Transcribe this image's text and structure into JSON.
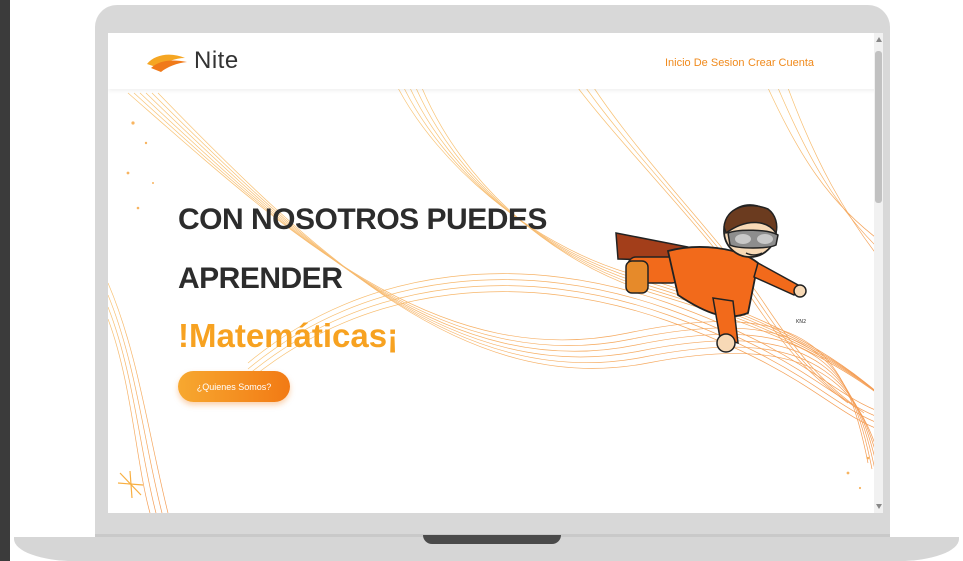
{
  "brand": {
    "name": "Nite"
  },
  "nav": {
    "login": "Inicio De Sesion",
    "signup": "Crear Cuenta"
  },
  "hero": {
    "line1": "CON NOSOTROS PUEDES",
    "line2": "APRENDER",
    "accent": "!Matemáticas¡",
    "cta": "¿Quienes Somos?",
    "figure_caption": "KN2"
  },
  "colors": {
    "accent": "#f7a221",
    "nav_link": "#f08a1c",
    "heading": "#2c2c2c"
  },
  "icons": {
    "logo": "nite-logo-icon",
    "scroll_up": "scroll-up-icon",
    "scroll_down": "scroll-down-icon"
  }
}
